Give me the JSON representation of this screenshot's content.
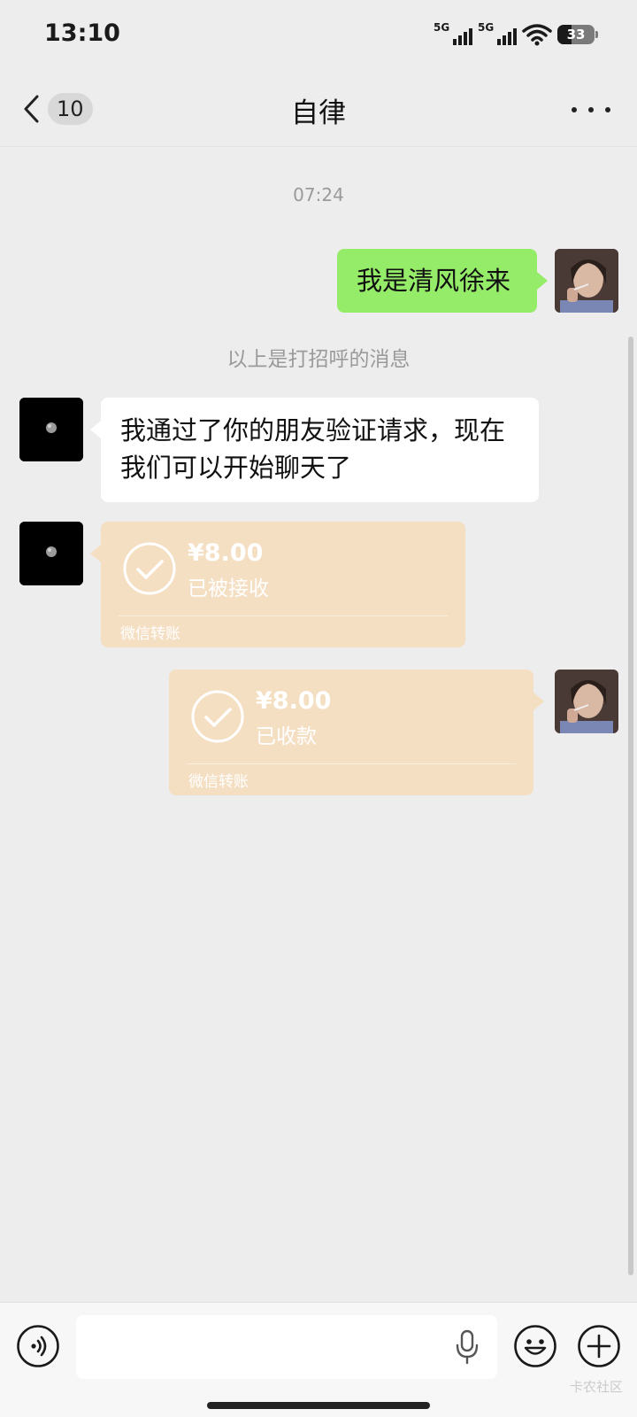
{
  "status_bar": {
    "time": "13:10",
    "sim1_label": "5G",
    "sim2_label": "5G",
    "battery_level": "33"
  },
  "nav": {
    "unread_count": "10",
    "title": "自律"
  },
  "chat": {
    "timestamp": "07:24",
    "messages": [
      {
        "sender": "self",
        "text": "我是清风徐来"
      },
      {
        "sender": "system",
        "text": "以上是打招呼的消息"
      },
      {
        "sender": "other",
        "text_line1": "我通过了你的朋友验证请求，现在",
        "text_line2": "我们可以开始聊天了"
      },
      {
        "sender": "other",
        "amount": "¥8.00",
        "state": "已被接收",
        "brand": "微信转账"
      },
      {
        "sender": "self",
        "amount": "¥8.00",
        "state": "已收款",
        "brand": "微信转账"
      }
    ]
  },
  "input": {
    "placeholder": "",
    "watermark": "卡农社区"
  },
  "colors": {
    "background": "#ededed",
    "self_bubble": "#95ec69",
    "other_bubble": "#ffffff",
    "transfer_bubble": "#f5dfc3"
  }
}
